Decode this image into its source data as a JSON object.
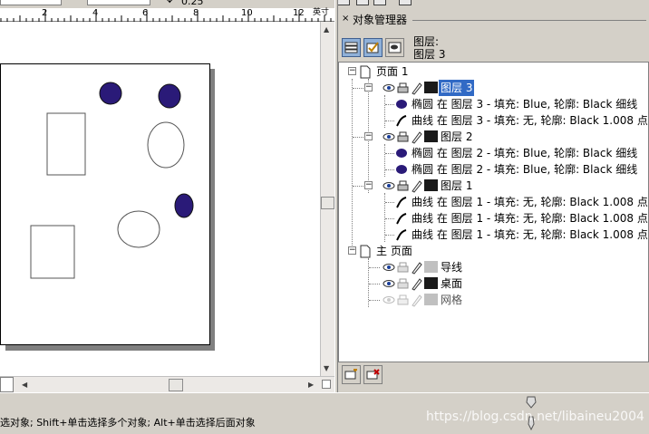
{
  "toolbar": {
    "nudge_value": "0.25"
  },
  "ruler": {
    "ticks": [
      "2",
      "4",
      "6",
      "8",
      "10",
      "12"
    ],
    "unit": "英寸"
  },
  "docker": {
    "title": "对象管理器",
    "close_glyph": "×",
    "buttons": [
      {
        "icon": "show-object-properties-icon",
        "active": true
      },
      {
        "icon": "edit-across-layers-icon",
        "active": true
      },
      {
        "icon": "layer-manager-view-icon",
        "active": false
      }
    ],
    "layer_caption": "图层:",
    "current_layer": "图层 3",
    "bottom_buttons": [
      {
        "icon": "new-layer-icon"
      },
      {
        "icon": "delete-icon"
      }
    ]
  },
  "tree": {
    "page1": {
      "label": "页面 1"
    },
    "layer3": {
      "label": "图层 3",
      "swatch": "#1a1a1a",
      "selected": true
    },
    "layer3_items": [
      {
        "label": "椭圆 在 图层 3 - 填充: Blue, 轮廓: Black  细线",
        "shape": "ellipse"
      },
      {
        "label": "曲线 在 图层 3 - 填充: 无, 轮廓: Black 1.008 点",
        "shape": "curve"
      }
    ],
    "layer2": {
      "label": "图层 2",
      "swatch": "#1a1a1a"
    },
    "layer2_items": [
      {
        "label": "椭圆 在 图层 2 - 填充: Blue, 轮廓: Black  细线",
        "shape": "ellipse"
      },
      {
        "label": "椭圆 在 图层 2 - 填充: Blue, 轮廓: Black  细线",
        "shape": "ellipse"
      }
    ],
    "layer1": {
      "label": "图层 1",
      "swatch": "#1a1a1a"
    },
    "layer1_items": [
      {
        "label": "曲线 在 图层 1 - 填充: 无, 轮廓: Black 1.008 点",
        "shape": "curve"
      },
      {
        "label": "曲线 在 图层 1 - 填充: 无, 轮廓: Black 1.008 点",
        "shape": "curve"
      },
      {
        "label": "曲线 在 图层 1 - 填充: 无, 轮廓: Black 1.008 点",
        "shape": "curve"
      }
    ],
    "master": {
      "label": "主 页面"
    },
    "master_layers": [
      {
        "label": "导线",
        "swatch": "#c0c0c0",
        "dimmed": false
      },
      {
        "label": "桌面",
        "swatch": "#1a1a1a",
        "dimmed": false
      },
      {
        "label": "网格",
        "swatch": "#c0c0c0",
        "dimmed": true
      }
    ]
  },
  "status": {
    "hint": "选对象; Shift+单击选择多个对象; Alt+单击选择后面对象",
    "watermark": "https://blog.csdn.net/libaineu2004"
  },
  "colors": {
    "ellipse_fill": "#2a1a78",
    "selection": "#316ac5",
    "panel_bg": "#d4d0c8"
  }
}
